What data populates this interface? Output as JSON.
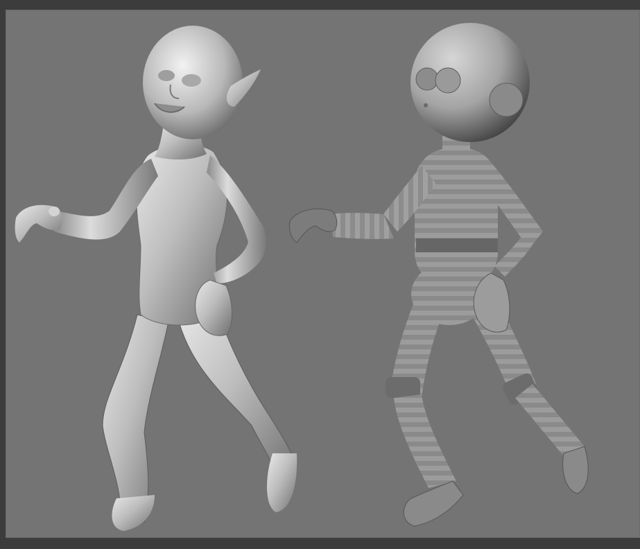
{
  "scene": {
    "background_color": "#747474",
    "frame_color": "#3c3c3c",
    "figures": [
      {
        "name": "sculpted-elf-character",
        "material": "smooth-grey-clay"
      },
      {
        "name": "segmented-proxy-rig",
        "material": "banded-grey-segments"
      }
    ]
  }
}
